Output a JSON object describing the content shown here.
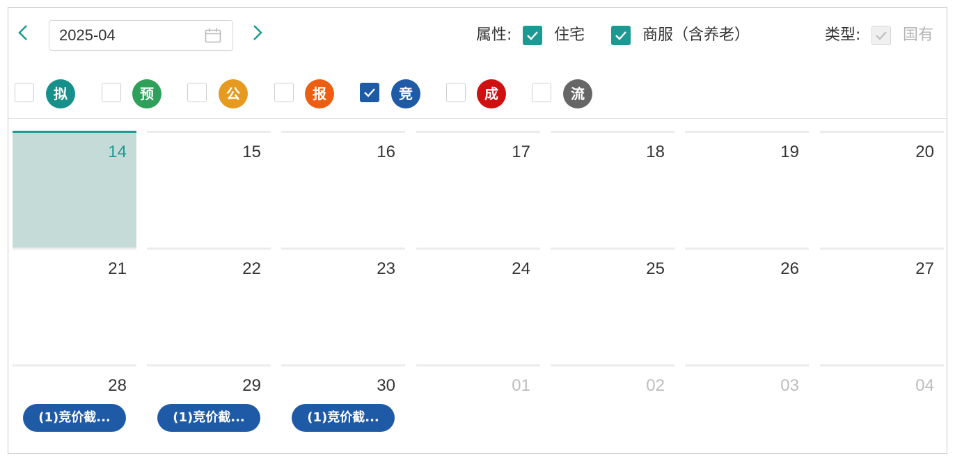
{
  "toolbar": {
    "month_value": "2025-04",
    "attribute_label": "属性:",
    "type_label": "类型:",
    "attributes": [
      {
        "label": "住宅",
        "checked": true
      },
      {
        "label": "商服（含养老）",
        "checked": true
      }
    ],
    "type_option": {
      "label": "国有",
      "checked": true,
      "disabled": true
    }
  },
  "statuses": [
    {
      "label": "拟",
      "color": "#17908c",
      "checked": false
    },
    {
      "label": "预",
      "color": "#2ea05a",
      "checked": false
    },
    {
      "label": "公",
      "color": "#e69a1f",
      "checked": false
    },
    {
      "label": "报",
      "color": "#ec5f12",
      "checked": false
    },
    {
      "label": "竞",
      "color": "#1f5aa6",
      "checked": true
    },
    {
      "label": "成",
      "color": "#d01010",
      "checked": false
    },
    {
      "label": "流",
      "color": "#666666",
      "checked": false
    }
  ],
  "calendar": {
    "weeks": [
      [
        {
          "day": "14",
          "today": true
        },
        {
          "day": "15"
        },
        {
          "day": "16"
        },
        {
          "day": "17"
        },
        {
          "day": "18"
        },
        {
          "day": "19"
        },
        {
          "day": "20"
        }
      ],
      [
        {
          "day": "21"
        },
        {
          "day": "22"
        },
        {
          "day": "23"
        },
        {
          "day": "24"
        },
        {
          "day": "25"
        },
        {
          "day": "26"
        },
        {
          "day": "27"
        }
      ],
      [
        {
          "day": "28",
          "event": "(1)竞价截..."
        },
        {
          "day": "29",
          "event": "(1)竞价截..."
        },
        {
          "day": "30",
          "event": "(1)竞价截..."
        },
        {
          "day": "01",
          "other_month": true
        },
        {
          "day": "02",
          "other_month": true
        },
        {
          "day": "03",
          "other_month": true
        },
        {
          "day": "04",
          "other_month": true
        }
      ]
    ]
  }
}
